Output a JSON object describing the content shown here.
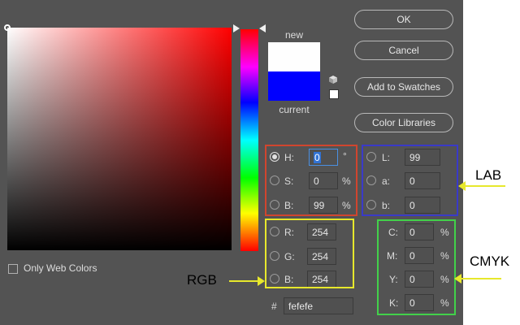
{
  "buttons": {
    "ok": "OK",
    "cancel": "Cancel",
    "add_to_swatches": "Add to Swatches",
    "color_libraries": "Color Libraries"
  },
  "swatch": {
    "new_label": "new",
    "current_label": "current",
    "new_color": "#fefefe",
    "current_color": "#0000ff"
  },
  "hsb": {
    "h_label": "H:",
    "h_value": "0",
    "h_unit": "°",
    "s_label": "S:",
    "s_value": "0",
    "s_unit": "%",
    "b_label": "B:",
    "b_value": "99",
    "b_unit": "%",
    "selected": "H"
  },
  "lab": {
    "l_label": "L:",
    "l_value": "99",
    "a_label": "a:",
    "a_value": "0",
    "b_label": "b:",
    "b_value": "0"
  },
  "rgb": {
    "r_label": "R:",
    "r_value": "254",
    "g_label": "G:",
    "g_value": "254",
    "b_label": "B:",
    "b_value": "254"
  },
  "cmyk": {
    "c_label": "C:",
    "c_value": "0",
    "c_unit": "%",
    "m_label": "M:",
    "m_value": "0",
    "m_unit": "%",
    "y_label": "Y:",
    "y_value": "0",
    "y_unit": "%",
    "k_label": "K:",
    "k_value": "0",
    "k_unit": "%"
  },
  "hex": {
    "hash": "#",
    "value": "fefefe"
  },
  "web_colors": {
    "label": "Only Web Colors",
    "checked": false
  },
  "annotations": {
    "lab": "LAB",
    "cmyk": "CMYK",
    "rgb": "RGB",
    "hsb_box_color": "#d0452e",
    "lab_box_color": "#3a3ac8",
    "rgb_box_color": "#e7e82c",
    "cmyk_box_color": "#42d14a"
  },
  "icons": {
    "gamut_warning": "cube-icon",
    "hue_slider": "triangle-arrow-icon"
  }
}
